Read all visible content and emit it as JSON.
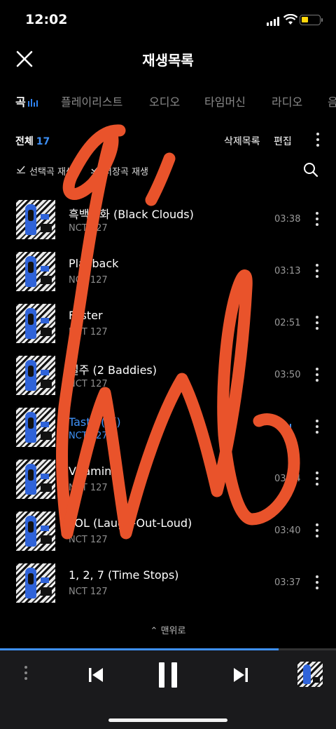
{
  "status_bar": {
    "time": "12:02"
  },
  "header": {
    "title": "재생목록"
  },
  "tabs": [
    {
      "label": "곡",
      "active": true
    },
    {
      "label": "플레이리스트"
    },
    {
      "label": "오디오"
    },
    {
      "label": "타임머신"
    },
    {
      "label": "라디오"
    },
    {
      "label": "음"
    }
  ],
  "list_toolbar": {
    "total_label": "전체",
    "total_count": "17",
    "deleted_label": "삭제목록",
    "edit_label": "편집"
  },
  "play_options": {
    "selected_label": "선택곡 재생",
    "saved_label": "저장곡 재생"
  },
  "tracks": [
    {
      "title": "흑백영화 (Black Clouds)",
      "artist": "NCT 127",
      "duration": "03:38"
    },
    {
      "title": "Playback",
      "artist": "NCT 127",
      "duration": "03:13"
    },
    {
      "title": "Faster",
      "artist": "NCT 127",
      "duration": "02:51"
    },
    {
      "title": "질주 (2 Baddies)",
      "artist": "NCT 127",
      "duration": "03:50"
    },
    {
      "title": "Tasty (貘)",
      "artist": "NCT 127",
      "duration": "",
      "playing": true
    },
    {
      "title": "Vitamin",
      "artist": "NCT 127",
      "duration": "03:34"
    },
    {
      "title": "LOL (Laugh-Out-Loud)",
      "artist": "NCT 127",
      "duration": "03:40"
    },
    {
      "title": "1, 2, 7 (Time Stops)",
      "artist": "NCT 127",
      "duration": "03:37"
    }
  ],
  "scroll_top": {
    "label": "맨위로"
  },
  "player": {
    "progress": 0.83
  },
  "colors": {
    "accent": "#3f91f6",
    "scribble": "#e9532b",
    "background": "#000000"
  }
}
